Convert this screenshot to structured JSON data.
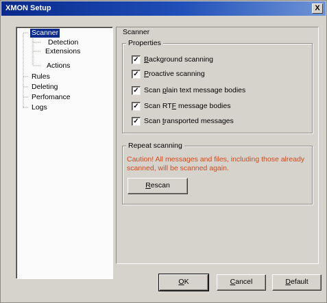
{
  "window": {
    "title": "XMON Setup",
    "close_glyph": "X"
  },
  "tree": {
    "items": [
      {
        "label": "Scanner",
        "selected": true,
        "level": 0
      },
      {
        "label": "Detection",
        "selected": false,
        "level": 1
      },
      {
        "label": "Extensions",
        "selected": false,
        "level": 1
      },
      {
        "label": "Actions",
        "selected": false,
        "level": 1
      },
      {
        "label": "Rules",
        "selected": false,
        "level": 0
      },
      {
        "label": "Deleting",
        "selected": false,
        "level": 0
      },
      {
        "label": "Perfomance",
        "selected": false,
        "level": 0
      },
      {
        "label": "Logs",
        "selected": false,
        "level": 0
      }
    ]
  },
  "panel": {
    "title": "Scanner",
    "properties": {
      "title": "Properties",
      "options": [
        {
          "label": "Background scanning",
          "mnemonic": "B",
          "rest": "ackground scanning",
          "checked": true
        },
        {
          "label": "Proactive scanning",
          "mnemonic": "P",
          "rest": "roactive scanning",
          "checked": true
        },
        {
          "label": "Scan plain text message bodies",
          "prefix": "Scan ",
          "mnemonic": "p",
          "rest": "lain text message bodies",
          "checked": true
        },
        {
          "label": "Scan RTF message bodies",
          "prefix": "Scan RT",
          "mnemonic": "F",
          "rest": " message bodies",
          "checked": true
        },
        {
          "label": "Scan transported messages",
          "prefix": "Scan ",
          "mnemonic": "t",
          "rest": "ransported messages",
          "checked": true
        }
      ]
    },
    "repeat": {
      "title": "Repeat scanning",
      "warning": "Caution! All messages and files, including those already scanned, will be scanned again.",
      "rescan_mnemonic": "R",
      "rescan_rest": "escan"
    }
  },
  "buttons": {
    "ok_mnemonic": "O",
    "ok_rest": "K",
    "cancel_mnemonic": "C",
    "cancel_rest": "ancel",
    "default_mnemonic": "D",
    "default_rest": "efault"
  },
  "colors": {
    "title_bar": "#0a2a8c",
    "selection": "#0a2a8c",
    "warning": "#d24a1c",
    "face": "#d6d3cc"
  },
  "icons": {
    "check": "check-mark-icon",
    "close": "close-icon"
  }
}
